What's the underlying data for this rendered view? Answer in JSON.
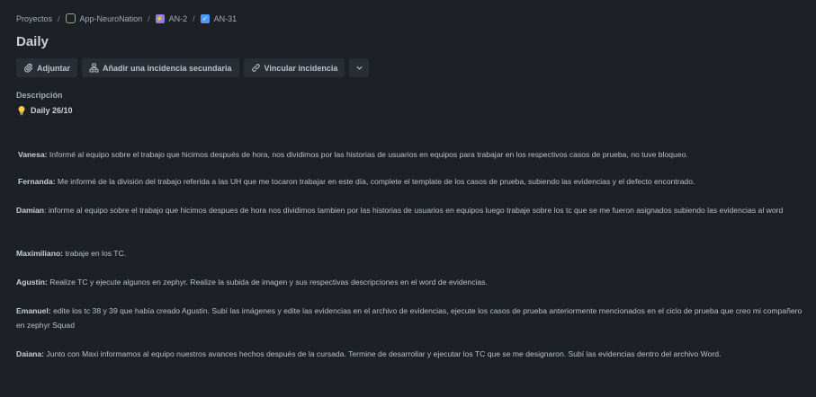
{
  "breadcrumb": {
    "root": "Proyectos",
    "project": "App-NeuroNation",
    "epic": "AN-2",
    "task": "AN-31"
  },
  "issue": {
    "title": "Daily"
  },
  "toolbar": {
    "attach": "Adjuntar",
    "add_child": "Añadir una incidencia secundaria",
    "link": "Vincular incidencia"
  },
  "description": {
    "label": "Descripción",
    "heading": "Daily 26/10",
    "entries": [
      {
        "name": "Vanesa:",
        "text": " Informé al equipo sobre el trabajo que hicimos después de hora, nos dividimos por las historias de usuarios en equipos para trabajar en los respectivos casos de prueba, no tuve bloqueo."
      },
      {
        "name": "Fernanda:",
        "text": " Me informé de la división del trabajo referida a las UH que me tocaron trabajar en este día, complete el template de los casos de prueba, subiendo las evidencias y el defecto encontrado."
      },
      {
        "name": "Damian",
        "text": ": informe al equipo sobre el trabajo que hicimos despues de hora nos dividimos tambien por las historias de usuarios  en equipos  luego trabaje sobre los tc que se me fueron asignados  subiendo las evidencias al word"
      },
      {
        "name": "Maximiliano:",
        "text": " trabaje en los TC."
      },
      {
        "name": "Agustin:",
        "text": " Realize TC y ejecute algunos en zephyr. Realize la subida de imagen y sus respectivas descripciones en el word de evidencias."
      },
      {
        "name": "Emanuel:",
        "text": " edite los tc 38 y 39 que había creado Agustin. Subí las imágenes y edite las evidencias en el archivo de evidencias, ejecute los casos de prueba anteriormente mencionados en el ciclo de prueba que creo mi compañero  en zephyr Squad"
      },
      {
        "name": "Daiana:",
        "text": " Junto con Maxi informamos al equipo nuestros avances hechos después de la cursada. Termine de desarrollar y ejecutar los TC que se me designaron. Subí las evidencias dentro del archivo Word."
      }
    ]
  }
}
